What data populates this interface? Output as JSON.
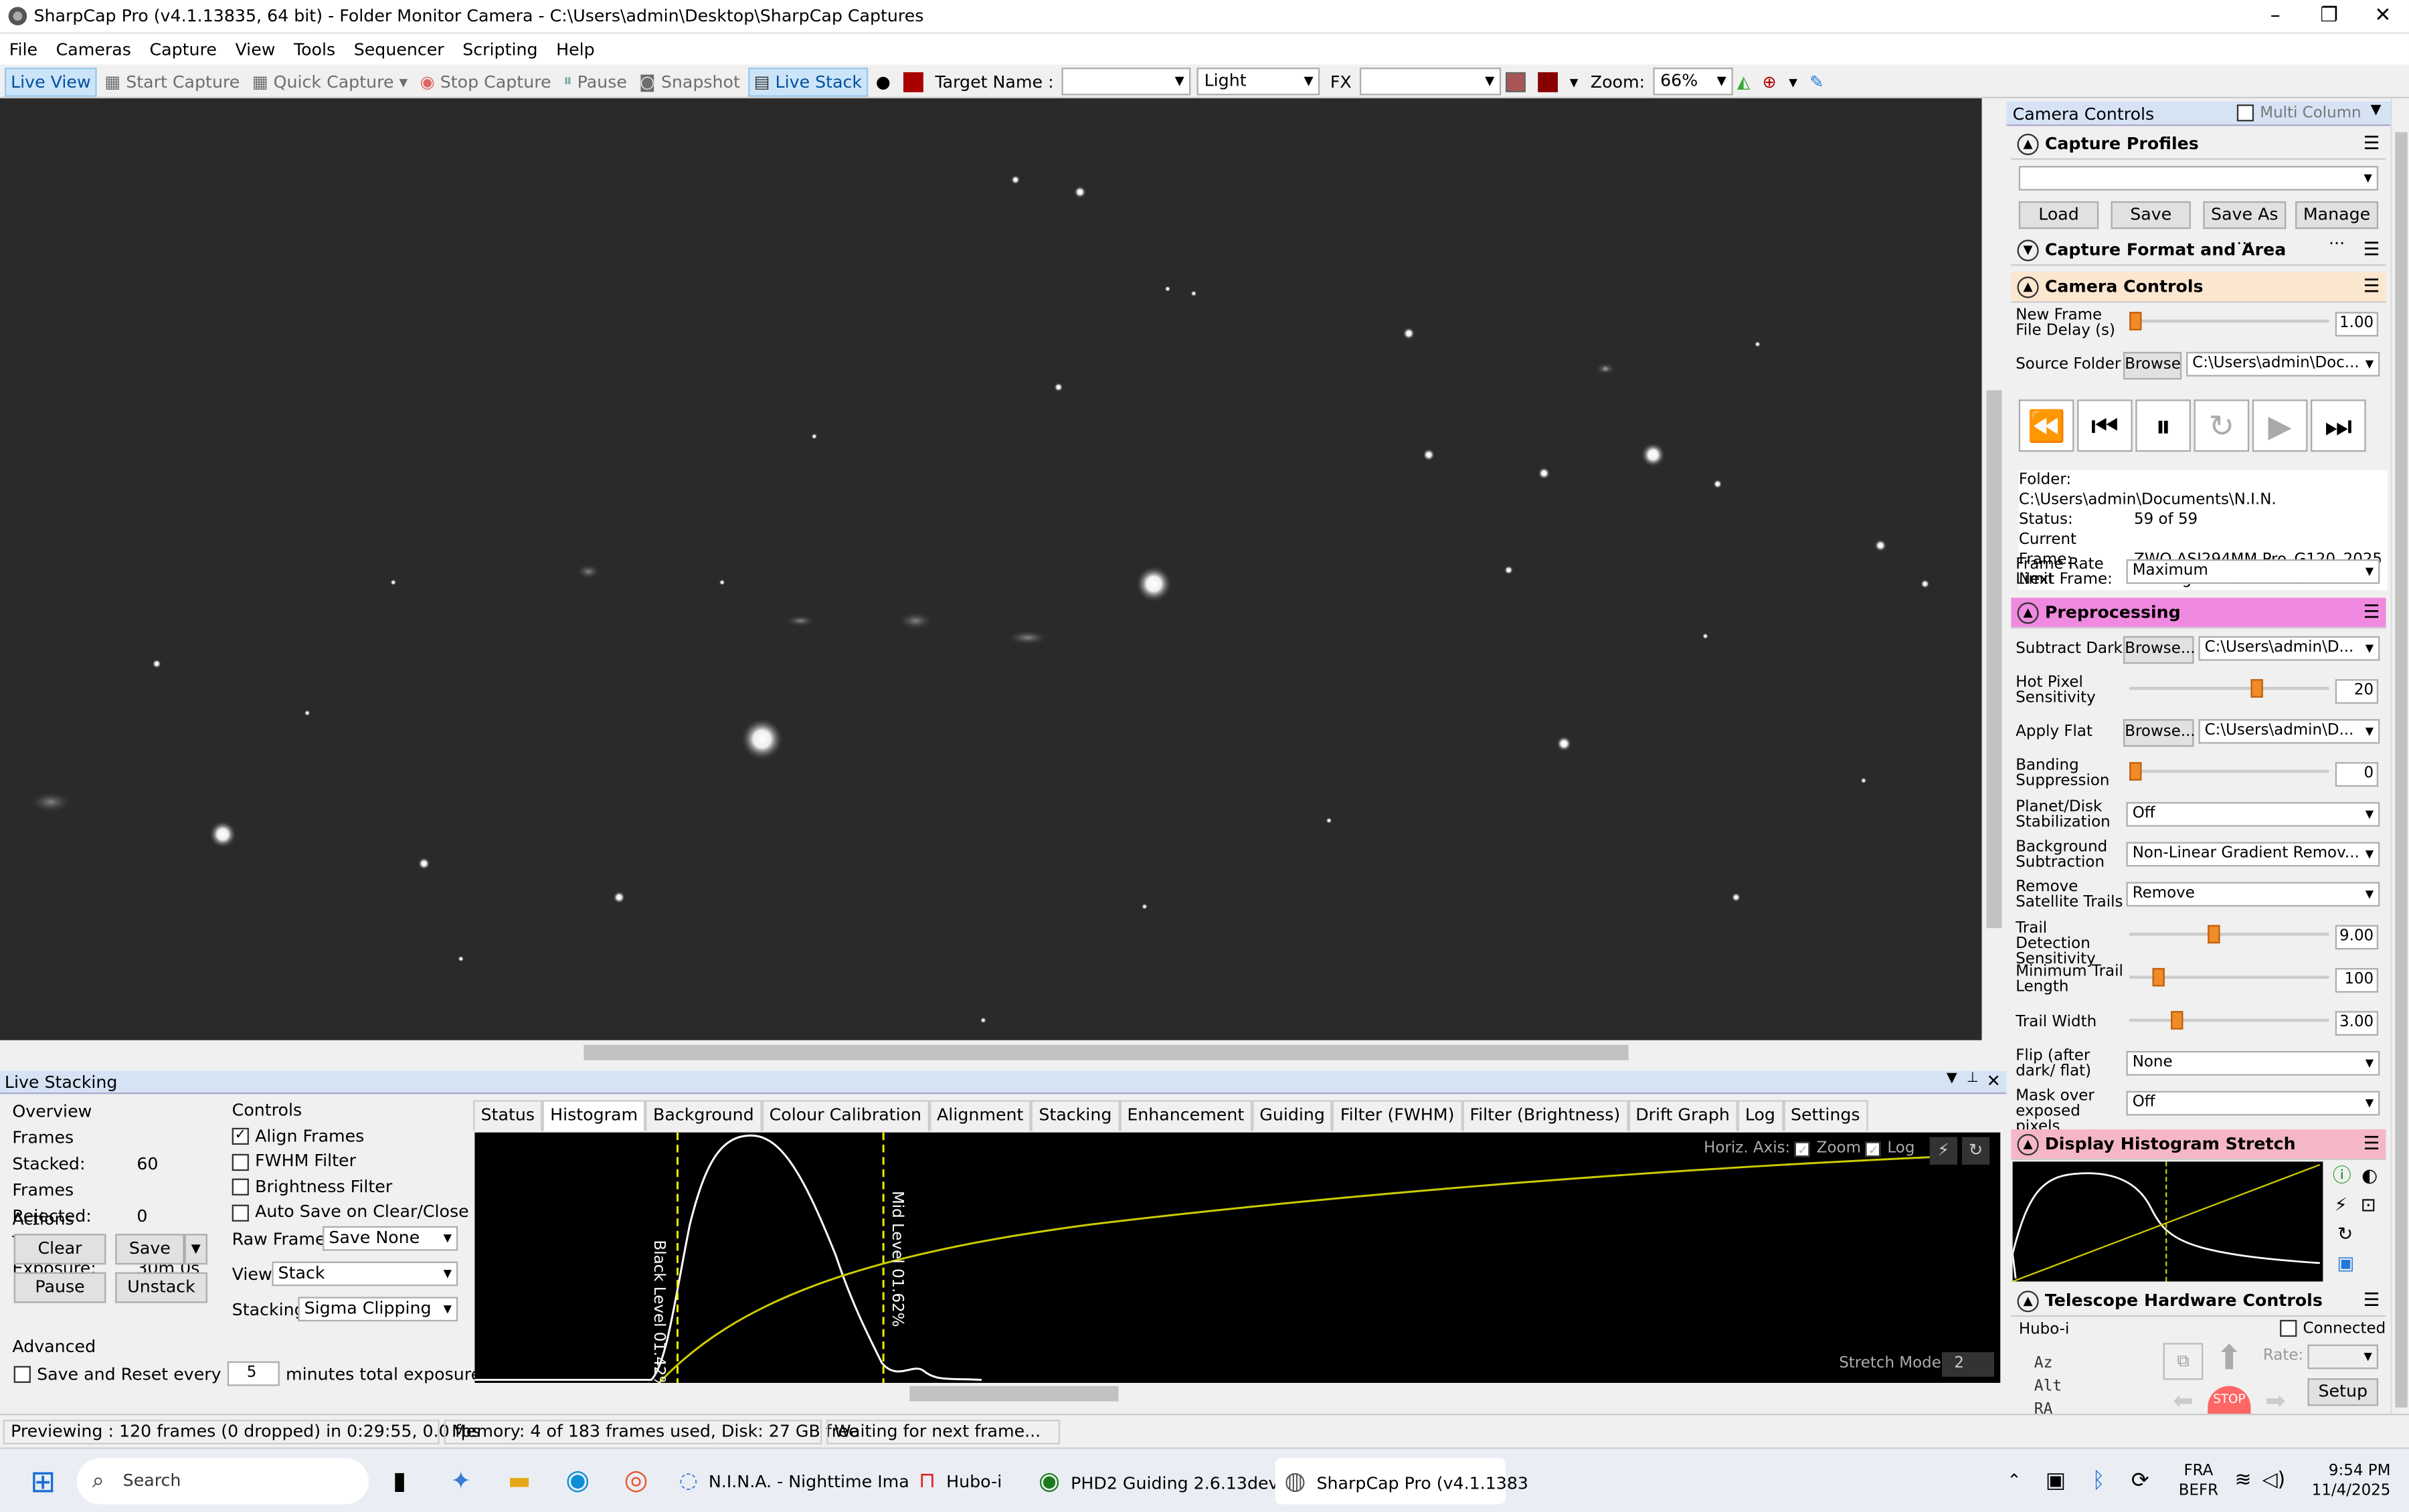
{
  "window": {
    "title": "SharpCap Pro (v4.1.13835, 64 bit) - Folder Monitor Camera - C:\\Users\\admin\\Desktop\\SharpCap Captures"
  },
  "menu": [
    "File",
    "Cameras",
    "Capture",
    "View",
    "Tools",
    "Sequencer",
    "Scripting",
    "Help"
  ],
  "toolbar": {
    "live_view": "Live View",
    "start_capture": "Start Capture",
    "quick_capture": "Quick Capture",
    "stop_capture": "Stop Capture",
    "pause": "Pause",
    "snapshot": "Snapshot",
    "live_stack": "Live Stack",
    "target_name_label": "Target Name :",
    "target_name_value": "",
    "frame_type": "Light",
    "fx_label": "FX",
    "fx_value": "",
    "zoom_label": "Zoom:",
    "zoom_value": "66%"
  },
  "right_panel": {
    "header": "Camera Controls",
    "multi_column": "Multi Column",
    "capture_profiles": {
      "title": "Capture Profiles",
      "load": "Load",
      "save": "Save",
      "save_as": "Save As ...",
      "manage": "Manage ..."
    },
    "capture_format": {
      "title": "Capture Format and Area"
    },
    "camera_controls": {
      "title": "Camera Controls",
      "delay_label": "New Frame File Delay (s)",
      "delay_value": "1.00",
      "delay_level": 0.0,
      "source_folder_label": "Source Folder",
      "browse": "Browse",
      "source_folder_value": "C:\\Users\\admin\\Doc...",
      "info": [
        {
          "k": "Folder:",
          "v": "C:\\Users\\admin\\Documents\\N.I.N."
        },
        {
          "k": "Status:",
          "v": "59 of 59"
        },
        {
          "k": "Current Frame:",
          "v": "ZWO ASI294MM Pro_G120_2025"
        },
        {
          "k": "Next Frame:",
          "v": "Waiting for next frame..."
        }
      ],
      "frame_rate_label": "Frame Rate Limit",
      "frame_rate_value": "Maximum"
    },
    "preprocessing": {
      "title": "Preprocessing",
      "subtract_dark_label": "Subtract Dark",
      "browse": "Browse...",
      "dark_value": "C:\\Users\\admin\\D...",
      "hot_pixel_label": "Hot Pixel Sensitivity",
      "hot_pixel_value": "20",
      "hot_pixel_level": 0.65,
      "apply_flat_label": "Apply Flat",
      "flat_value": "C:\\Users\\admin\\D...",
      "banding_label": "Banding Suppression",
      "banding_value": "0",
      "banding_level": 0.0,
      "planet_label": "Planet/Disk Stabilization",
      "planet_value": "Off",
      "bg_label": "Background Subtraction",
      "bg_value": "Non-Linear Gradient Remov...",
      "sat_label": "Remove Satellite Trails",
      "sat_value": "Remove",
      "trail_sens_label": "Trail Detection Sensitivity",
      "trail_sens_value": "9.00",
      "trail_sens_level": 0.42,
      "min_trail_label": "Minimum Trail Length",
      "min_trail_value": "100",
      "min_trail_level": 0.12,
      "trail_width_label": "Trail Width",
      "trail_width_value": "3.00",
      "trail_width_level": 0.22,
      "flip_label": "Flip (after dark/ flat)",
      "flip_value": "None",
      "mask_label": "Mask over exposed pixels",
      "mask_value": "Off"
    },
    "display_histogram": {
      "title": "Display Histogram Stretch"
    },
    "telescope": {
      "title": "Telescope Hardware Controls",
      "mount": "Hubo-i",
      "connected": "Connected",
      "az": "Az",
      "alt": "Alt",
      "ra": "RA",
      "rate": "Rate:",
      "setup": "Setup",
      "stop": "STOP"
    }
  },
  "live_stacking": {
    "title": "Live Stacking",
    "overview": {
      "title": "Overview",
      "frames_stacked_label": "Frames Stacked:",
      "frames_stacked": "60",
      "frames_rejected_label": "Frames Rejected:",
      "frames_rejected": "0",
      "total_exposure_label": "Total Exposure:",
      "total_exposure": "30m 0s"
    },
    "actions": {
      "title": "Actions",
      "clear": "Clear",
      "save": "Save",
      "pause": "Pause",
      "unstack": "Unstack"
    },
    "advanced": {
      "title": "Advanced",
      "save_reset_label": "Save and Reset every",
      "save_reset_value": "5",
      "minutes_label": "minutes total exposure"
    },
    "controls": {
      "title": "Controls",
      "align_frames": "Align Frames",
      "fwhm_filter": "FWHM Filter",
      "brightness_filter": "Brightness Filter",
      "auto_save": "Auto Save on Clear/Close",
      "raw_frames_label": "Raw Frames",
      "raw_frames_value": "Save None",
      "view_label": "View",
      "view_value": "Stack",
      "stacking_label": "Stacking",
      "stacking_value": "Sigma Clipping"
    },
    "tabs": [
      "Status",
      "Histogram",
      "Background",
      "Colour Calibration",
      "Alignment",
      "Stacking",
      "Enhancement",
      "Guiding",
      "Filter (FWHM)",
      "Filter (Brightness)",
      "Drift Graph",
      "Log",
      "Settings"
    ],
    "histogram": {
      "horiz_axis": "Horiz. Axis:",
      "zoom": "Zoom",
      "log": "Log",
      "black_level": "Black Level 01.42%",
      "mid_level": "Mid Level 01.62%",
      "stretch_mode": "Stretch Mode",
      "stretch_value": "2"
    }
  },
  "status": {
    "preview": "Previewing : 120 frames (0 dropped) in 0:29:55, 0.0 fps",
    "memory": "Memory: 4 of 183 frames used, Disk: 27 GB free",
    "waiting": "Waiting for next frame..."
  },
  "taskbar": {
    "search": "Search",
    "apps": [
      "N.I.N.A. - Nighttime Ima",
      "Hubo-i",
      "PHD2 Guiding 2.6.13dev",
      "SharpCap Pro (v4.1.1383"
    ],
    "lang1": "FRA",
    "lang2": "BEFR",
    "time": "9:54 PM",
    "date": "11/4/2025"
  }
}
